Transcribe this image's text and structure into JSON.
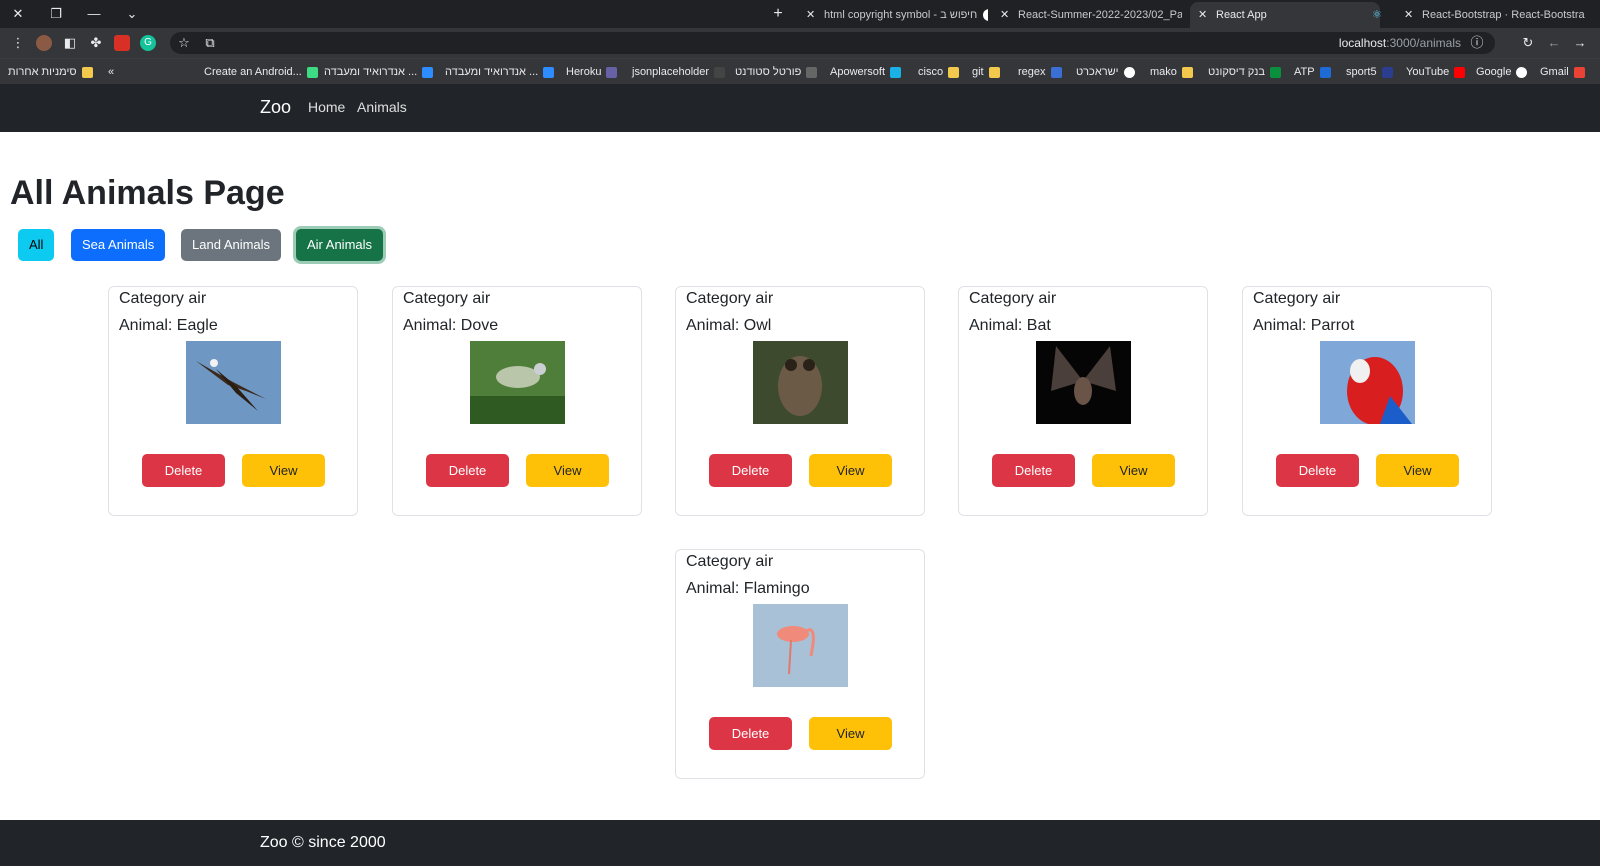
{
  "browser": {
    "tabs": [
      {
        "label": "html copyright symbol - חיפוש ב",
        "active": false
      },
      {
        "label": "React-Summer-2022-2023/02_Pa",
        "active": false
      },
      {
        "label": "React App",
        "active": true
      },
      {
        "label": "React-Bootstrap · React-Bootstra",
        "active": false
      }
    ],
    "url_host": "localhost",
    "url_path": ":3000/animals",
    "bookmarks": [
      "Gmail",
      "Google",
      "YouTube",
      "sport5",
      "ATP",
      "בנק דיסקונט",
      "mako",
      "ישראכרט",
      "regex",
      "git",
      "cisco",
      "Apowersoft",
      "פורטל סטודנט",
      "jsonplaceholder",
      "Heroku",
      "אנדרואיד ומעבדה ...",
      "אנדרואיד ומעבדה ...",
      "Create an Android...",
      "סימניות אחרות"
    ]
  },
  "navbar": {
    "brand": "Zoo",
    "links": [
      "Home",
      "Animals"
    ]
  },
  "page": {
    "title": "All Animals Page",
    "filters": [
      {
        "label": "All",
        "color": "#0dcaf0"
      },
      {
        "label": "Sea Animals",
        "color": "#0d6efd"
      },
      {
        "label": "Land Animals",
        "color": "#6c757d"
      },
      {
        "label": "Air Animals",
        "color": "#198754",
        "active": true
      }
    ],
    "cards": [
      {
        "category": "Category air",
        "animal": "Animal: Eagle",
        "image": "eagle-photo",
        "delete_label": "Delete",
        "view_label": "View"
      },
      {
        "category": "Category air",
        "animal": "Animal: Dove",
        "image": "dove-photo",
        "delete_label": "Delete",
        "view_label": "View"
      },
      {
        "category": "Category air",
        "animal": "Animal: Owl",
        "image": "owl-photo",
        "delete_label": "Delete",
        "view_label": "View"
      },
      {
        "category": "Category air",
        "animal": "Animal: Bat",
        "image": "bat-photo",
        "delete_label": "Delete",
        "view_label": "View"
      },
      {
        "category": "Category air",
        "animal": "Animal: Parrot",
        "image": "parrot-photo",
        "delete_label": "Delete",
        "view_label": "View"
      },
      {
        "category": "Category air",
        "animal": "Animal: Flamingo",
        "image": "flamingo-photo",
        "delete_label": "Delete",
        "view_label": "View"
      }
    ]
  },
  "footer": {
    "text": "Zoo © since 2000"
  }
}
